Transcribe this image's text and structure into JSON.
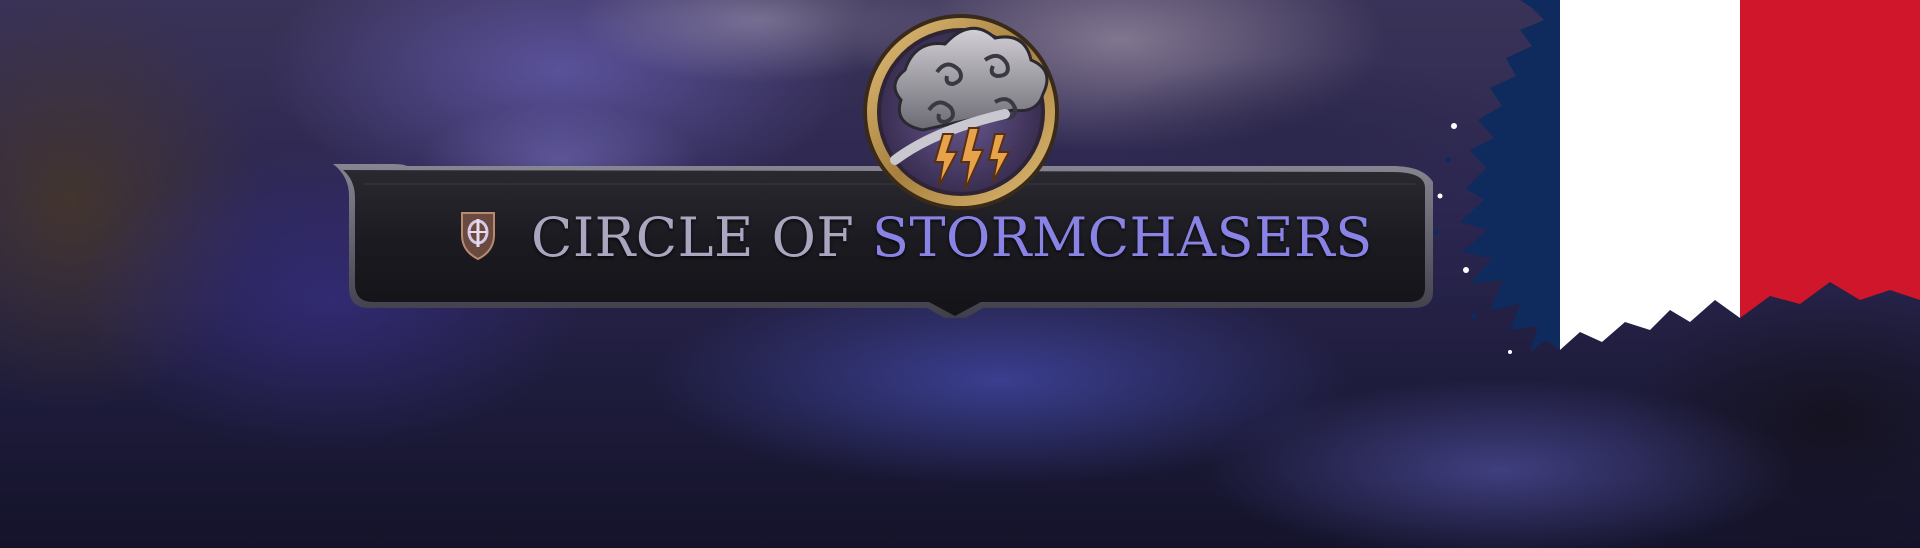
{
  "banner": {
    "title_part1": "CIRCLE OF ",
    "title_part2": "STORMCHASERS"
  },
  "icons": {
    "subclass": "shield-emblem-icon",
    "medallion": "storm-cloud-lightning-icon",
    "flag": "french-flag-icon"
  },
  "colors": {
    "title_gray": "#a9a6bf",
    "title_violet": "#8a83e6",
    "plate": "#1c1b21",
    "plate_border": "#5a5862",
    "medallion_gold": "#c8a160",
    "medallion_inner": "#5a4b7a",
    "flag_blue": "#0f2a5c",
    "flag_white": "#ffffff",
    "flag_red": "#d0162a"
  }
}
